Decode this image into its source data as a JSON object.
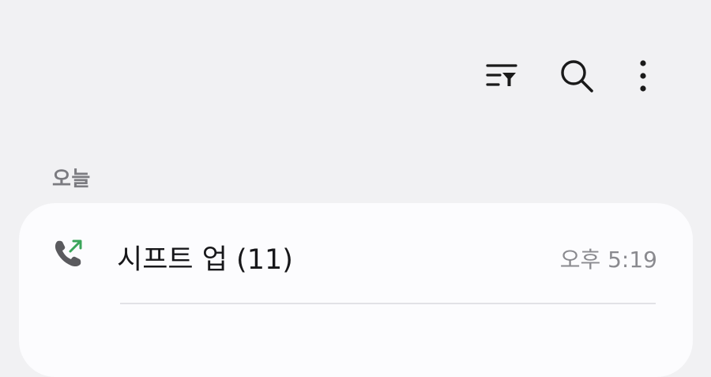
{
  "toolbar": {
    "filter_icon": "filter-list-icon",
    "search_icon": "search-icon",
    "more_icon": "more-vertical-icon"
  },
  "section": {
    "header": "오늘"
  },
  "call_log": [
    {
      "name": "시프트 업 (11)",
      "time": "오후 5:19",
      "type": "outgoing",
      "icon": "outgoing-call-icon",
      "arrow_color": "#3aa55a"
    }
  ],
  "colors": {
    "background": "#f1f1f3",
    "card": "#fcfcfe",
    "icon": "#1a1a1a",
    "secondary_text": "#8a8a8f"
  }
}
